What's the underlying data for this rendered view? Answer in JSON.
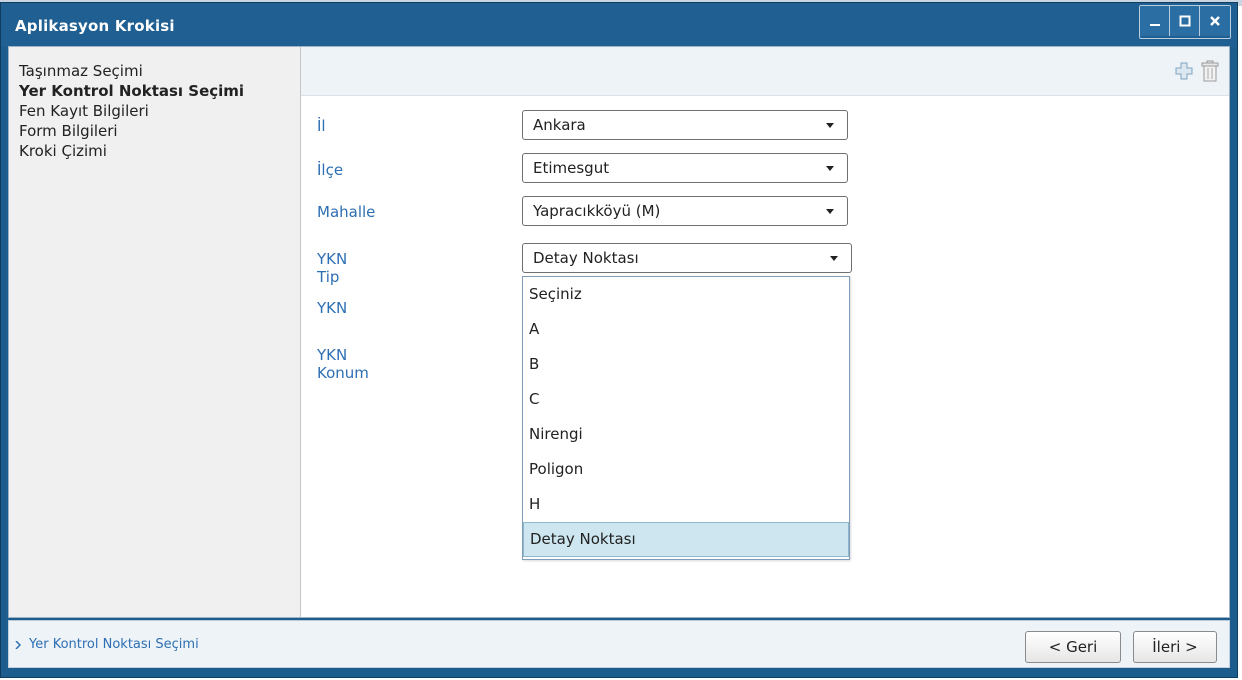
{
  "window": {
    "title": "Aplikasyon Krokisi"
  },
  "sidebar": {
    "items": [
      {
        "label": "Taşınmaz Seçimi"
      },
      {
        "label": "Yer Kontrol Noktası Seçimi"
      },
      {
        "label": "Fen Kayıt Bilgileri"
      },
      {
        "label": "Form Bilgileri"
      },
      {
        "label": "Kroki Çizimi"
      }
    ],
    "active_index": 1
  },
  "toolbar": {
    "icons": [
      "plus-icon",
      "trash-icon"
    ]
  },
  "form": {
    "il": {
      "label": "İl",
      "value": "Ankara"
    },
    "ilce": {
      "label": "İlçe",
      "value": "Etimesgut"
    },
    "mahalle": {
      "label": "Mahalle",
      "value": "Yapracıkköyü (M)"
    },
    "ykn_tip": {
      "label": "YKN Tip",
      "value": "Detay Noktası"
    },
    "ykn": {
      "label": "YKN"
    },
    "ykn_konum": {
      "label": "YKN Konum"
    }
  },
  "dropdown": {
    "options": [
      "Seçiniz",
      "A",
      "B",
      "C",
      "Nirengi",
      "Poligon",
      "H",
      "Detay Noktası"
    ],
    "selected": "Detay Noktası"
  },
  "footer": {
    "breadcrumb": "Yer Kontrol Noktası Seçimi",
    "back_label": "< Geri",
    "next_label": "İleri >"
  },
  "colors": {
    "titlebar": "#1f5f91",
    "label": "#2d6fb3",
    "selected_option": "#cde6ef"
  }
}
